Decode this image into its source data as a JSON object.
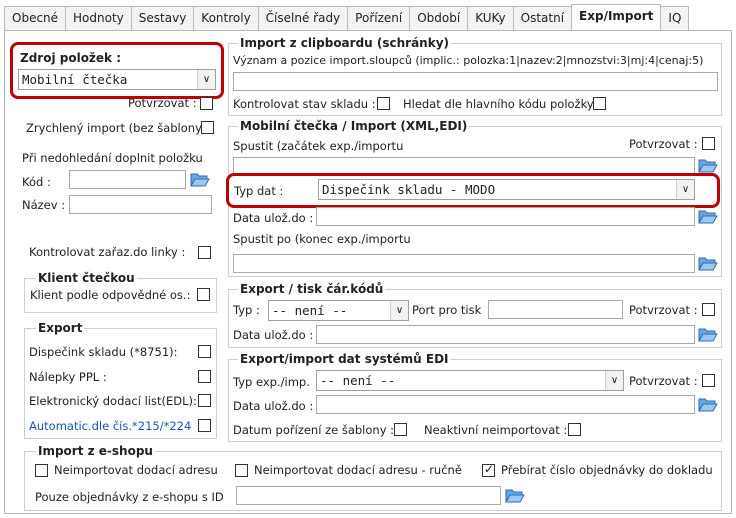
{
  "tabs": [
    "Obecné",
    "Hodnoty",
    "Sestavy",
    "Kontroly",
    "Číselné řady",
    "Pořízení",
    "Období",
    "KUKy",
    "Ostatní",
    "Exp/Import",
    "IQ"
  ],
  "source": {
    "title": "Zdroj položek :",
    "value": "Mobilní čtečka",
    "confirm": "Potvrzovat :"
  },
  "quick_import": "Zrychlený import (bez šablony)",
  "fill_missing": "Při nedohledání doplnit položku",
  "code_label": "Kód :",
  "name_label": "Název :",
  "check_line": "Kontrolovat zařaz.do linky :",
  "client": {
    "title": "Klient čtečkou",
    "label": "Klient podle odpovědné os.:"
  },
  "export": {
    "title": "Export",
    "items": [
      "Dispečink skladu (*8751):",
      "Nálepky PPL :",
      "Elektronický dodací list(EDL):",
      "Automatic.dle čís.*215/*224"
    ]
  },
  "clipboard": {
    "title": "Import z clipboardu (schránky)",
    "desc": "Význam a pozice import.sloupců (implic.: polozka:1|nazev:2|mnozstvi:3|mj:4|cenaj:5)",
    "stock": "Kontrolovat stav skladu :",
    "main_code": "Hledat dle hlavního kódu položky"
  },
  "mobile": {
    "title": "Mobilní čtečka / Import (XML,EDI)",
    "start": "Spustit (začátek exp./importu",
    "confirm": "Potvrzovat :",
    "type_label": "Typ dat :",
    "type_value": "Dispečink skladu - MODO",
    "save_label": "Data ulož.do :",
    "after_label": "Spustit po (konec exp./importu"
  },
  "barcode": {
    "title": "Export / tisk čár.kódů",
    "type_label": "Typ :",
    "type_value": "-- není --",
    "port_label": "Port pro tisk",
    "confirm": "Potvrzovat :",
    "save_label": "Data ulož.do :"
  },
  "edi": {
    "title": "Export/import dat systémů EDI",
    "type_label": "Typ exp./imp.",
    "type_value": "-- není --",
    "confirm": "Potvrzovat :",
    "save_label": "Data ulož.do :",
    "date_label": "Datum pořízení ze šablony :",
    "inactive_label": "Neaktivní neimportovat :"
  },
  "eshop": {
    "title": "Import z e-shopu",
    "opt1": "Neimportovat dodací adresu",
    "opt2": "Neimportovat dodací adresu - ručně",
    "opt3": "Přebírat číslo objednávky do dokladu",
    "id_label": "Pouze objednávky z e-shopu s ID"
  },
  "colors": {
    "accent": "#c00000",
    "link": "#1a56b8"
  }
}
